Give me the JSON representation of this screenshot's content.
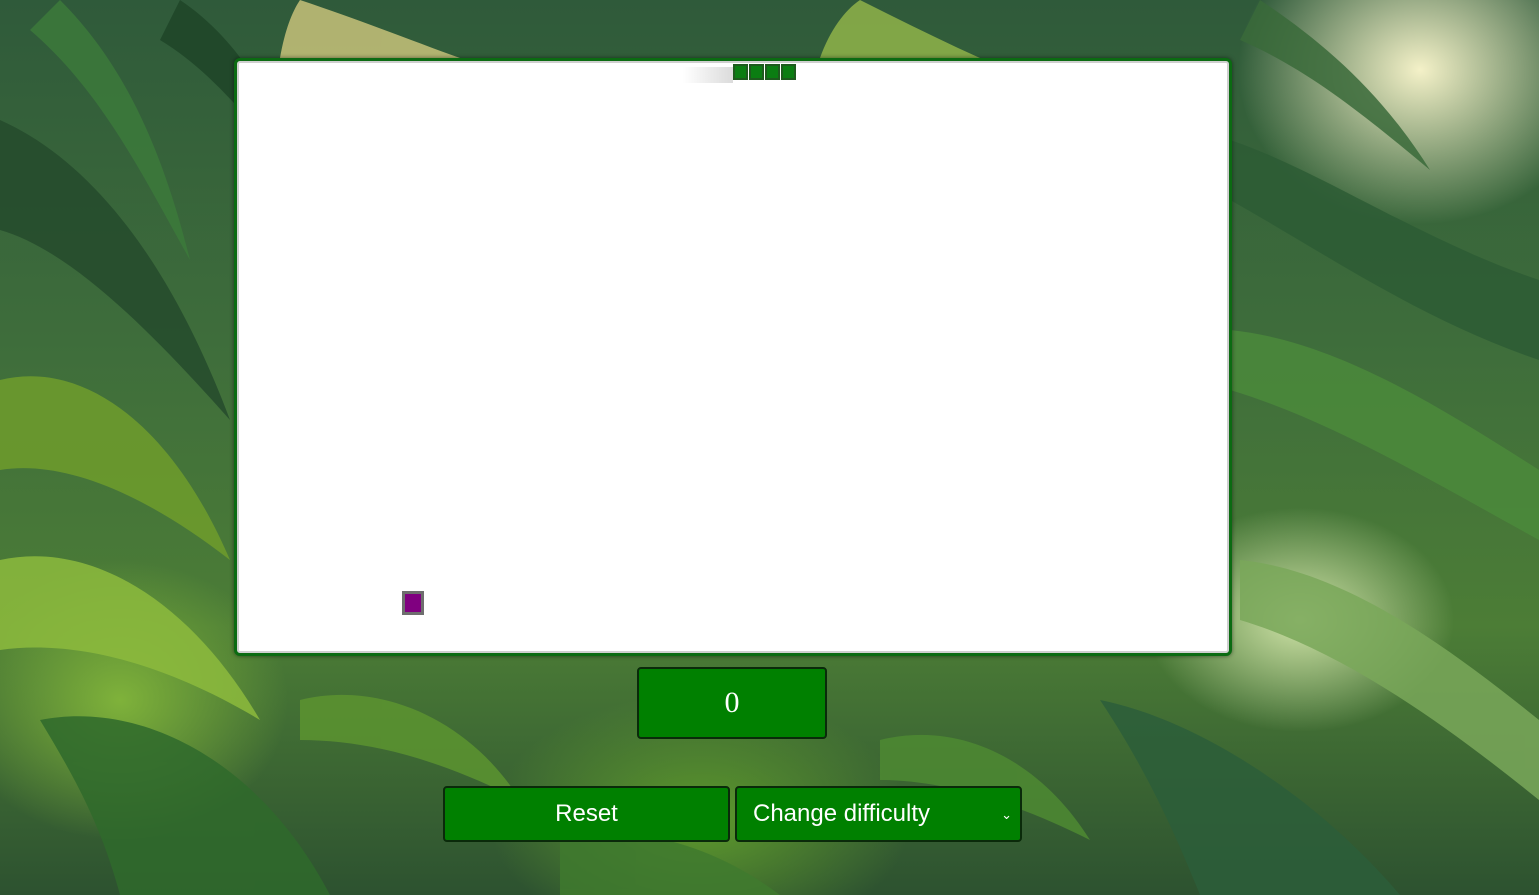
{
  "game": {
    "score": "0",
    "snake": {
      "color": "#0b7d12",
      "segments": 4
    },
    "food": {
      "color": "#800080"
    },
    "board": {
      "background": "#ffffff",
      "border_color": "#0b6b12"
    }
  },
  "controls": {
    "reset_label": "Reset",
    "difficulty_label": "Change difficulty",
    "difficulty_icon": "chevron-down-icon",
    "button_color": "#008000"
  }
}
